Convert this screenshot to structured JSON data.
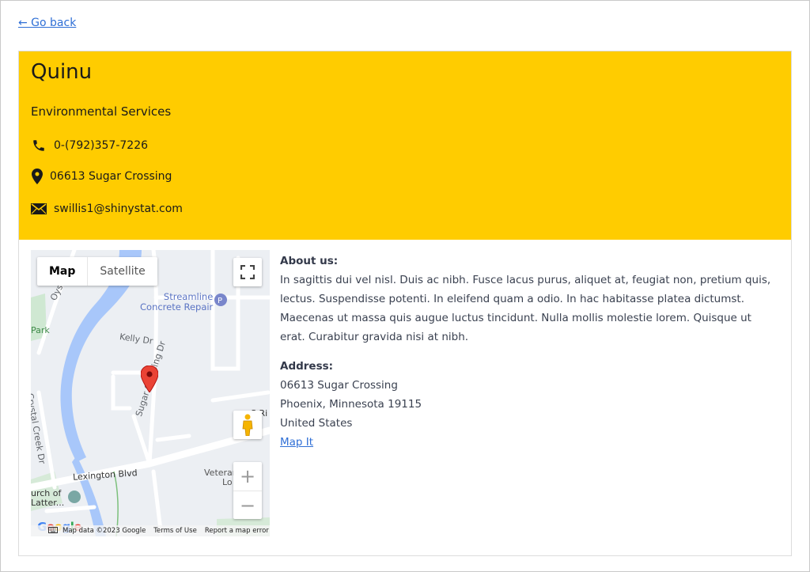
{
  "nav": {
    "back_label": "← Go back"
  },
  "listing": {
    "name": "Quinu",
    "category": "Environmental Services",
    "phone": "0-(792)357-7226",
    "street": "06613 Sugar Crossing",
    "email": "swillis1@shinystat.com"
  },
  "map": {
    "tab_map": "Map",
    "tab_satellite": "Satellite",
    "labels": {
      "oyster": "Oyster Poi",
      "park": "Park",
      "poi_name_line1": "Streamline",
      "poi_name_line2": "Concrete Repair",
      "kelly": "Kelly Dr",
      "sugar": "Sugar Crossing Dr",
      "crystal": "Crystal Creek Dr",
      "lexington": "Lexington Blvd",
      "church_line1": "urch of",
      "church_line2": "Latter...",
      "veteran_line1": "Veteran",
      "veteran_line2": "Lo",
      "right_top": "S  Ri"
    },
    "footer": {
      "data": "Map data ©2023 Google",
      "terms": "Terms of Use",
      "report": "Report a map error"
    },
    "logo": "Google",
    "zoom_in": "+",
    "zoom_out": "−"
  },
  "about": {
    "heading": "About us:",
    "text": "In sagittis dui vel nisl. Duis ac nibh. Fusce lacus purus, aliquet at, feugiat non, pretium quis, lectus. Suspendisse potenti. In eleifend quam a odio. In hac habitasse platea dictumst. Maecenas ut massa quis augue luctus tincidunt. Nulla mollis molestie lorem. Quisque ut erat. Curabitur gravida nisi at nibh."
  },
  "address": {
    "heading": "Address:",
    "line1": "06613 Sugar Crossing",
    "line2": "Phoenix, Minnesota 19115",
    "line3": "United States",
    "map_link": "Map It"
  },
  "colors": {
    "header_bg": "#ffcc00",
    "link": "#2f6fd6",
    "water": "#a8c7fa",
    "marker": "#ea4335"
  },
  "icons": [
    "phone-icon",
    "location-pin-icon",
    "envelope-icon",
    "fullscreen-icon",
    "pegman-icon",
    "map-marker-icon",
    "keyboard-icon"
  ]
}
